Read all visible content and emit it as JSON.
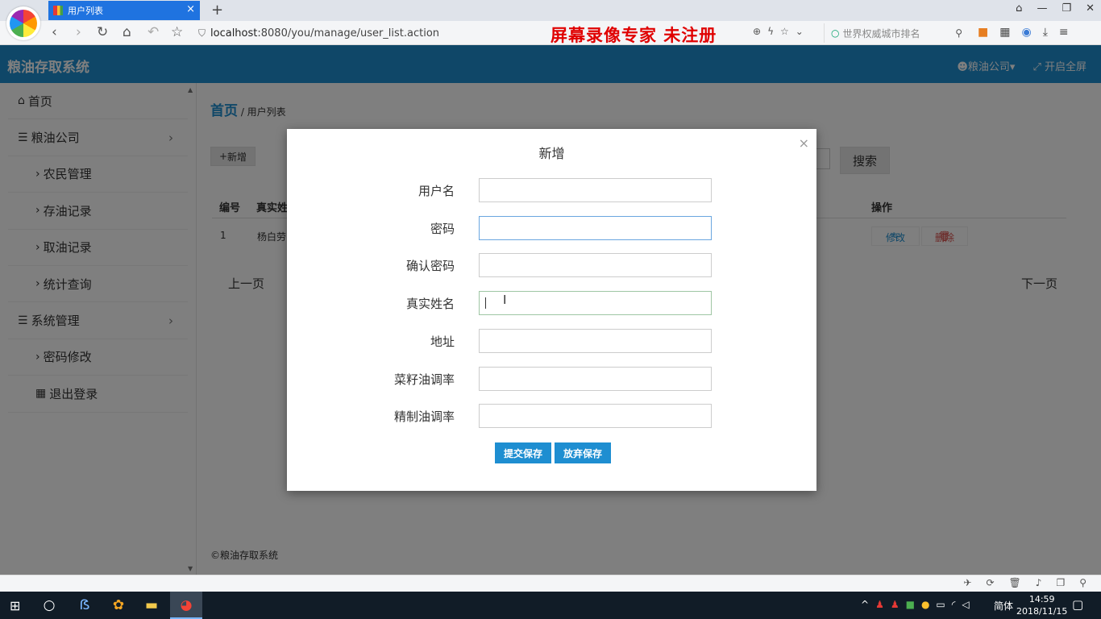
{
  "browser": {
    "tab_title": "用户列表",
    "tab_close": "×",
    "new_tab": "+",
    "url_host": "localhost",
    "url_path": ":8080/you/manage/user_list.action",
    "watermark": "屏幕录像专家  未注册",
    "search_placeholder": "世界权威城市排名"
  },
  "app": {
    "title": "粮油存取系统",
    "user_menu": "粮油公司",
    "fullscreen": "开启全屏"
  },
  "sidebar": {
    "items": [
      {
        "label": "首页",
        "icon": "home-icon",
        "type": "top"
      },
      {
        "label": "粮油公司",
        "icon": "list-icon",
        "type": "top",
        "arrow": "›"
      },
      {
        "label": "农民管理",
        "type": "sub"
      },
      {
        "label": "存油记录",
        "type": "sub"
      },
      {
        "label": "取油记录",
        "type": "sub"
      },
      {
        "label": "统计查询",
        "type": "sub"
      },
      {
        "label": "系统管理",
        "icon": "list-icon",
        "type": "top",
        "arrow": "›"
      },
      {
        "label": "密码修改",
        "type": "sub"
      },
      {
        "label": "退出登录",
        "icon": "grid-icon",
        "type": "sub"
      }
    ]
  },
  "main": {
    "breadcrumb_home": "首页",
    "breadcrumb_sep": " / ",
    "breadcrumb_current": "用户列表",
    "add_label": "新增",
    "search_label": "搜索",
    "table": {
      "headers": [
        "编号",
        "真实姓",
        "操作"
      ],
      "rows": [
        {
          "id": "1",
          "name": "杨白劳"
        }
      ],
      "edit_label": "修改",
      "delete_label": "删除"
    },
    "prev_page": "上一页",
    "next_page": "下一页",
    "footer": "©粮油存取系统"
  },
  "modal": {
    "title": "新增",
    "close": "×",
    "fields": [
      {
        "label": "用户名",
        "value": ""
      },
      {
        "label": "密码",
        "value": ""
      },
      {
        "label": "确认密码",
        "value": ""
      },
      {
        "label": "真实姓名",
        "value": ""
      },
      {
        "label": "地址",
        "value": ""
      },
      {
        "label": "菜籽油调率",
        "value": ""
      },
      {
        "label": "精制油调率",
        "value": ""
      }
    ],
    "submit_label": "提交保存",
    "cancel_label": "放弃保存"
  },
  "taskbar": {
    "ime": "简体",
    "time": "14:59",
    "date": "2018/11/15"
  },
  "colors": {
    "primary": "#1e8ed1",
    "danger": "#d9534f",
    "watermark": "#e00000"
  }
}
